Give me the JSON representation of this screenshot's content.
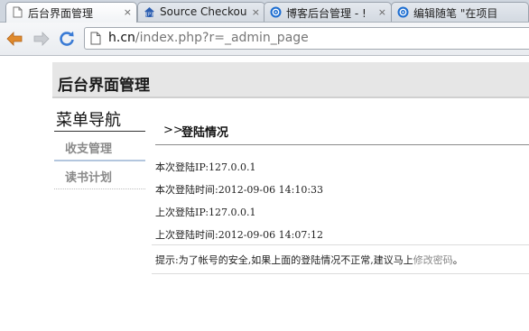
{
  "browser": {
    "tabs": [
      {
        "title": "后台界面管理",
        "icon": "page-icon",
        "active": true
      },
      {
        "title": "Source Checkou",
        "icon": "google-code-icon",
        "active": false
      },
      {
        "title": "博客后台管理 - !",
        "icon": "blog-icon",
        "active": false
      },
      {
        "title": "编辑随笔 \"在项目",
        "icon": "blog-icon",
        "active": false
      }
    ],
    "close_glyph": "×",
    "url_host": "h.cn",
    "url_path": "/index.php?r=_admin_page"
  },
  "page": {
    "site_title": "后台界面管理",
    "nav": {
      "title": "菜单导航",
      "items": [
        {
          "label": "收支管理"
        },
        {
          "label": "读书计划"
        }
      ]
    },
    "section": {
      "arrows": ">>",
      "title": "登陆情况"
    },
    "info": {
      "this_ip": "本次登陆IP:127.0.0.1",
      "this_time": "本次登陆时间:2012-09-06 14:10:33",
      "last_ip": "上次登陆IP:127.0.0.1",
      "last_time": "上次登陆时间:2012-09-06 14:07:12"
    },
    "tip": {
      "prefix": "提示:为了帐号的安全,如果上面的登陆情况不正常,建议马上",
      "link": "修改密码",
      "suffix": "。"
    }
  }
}
